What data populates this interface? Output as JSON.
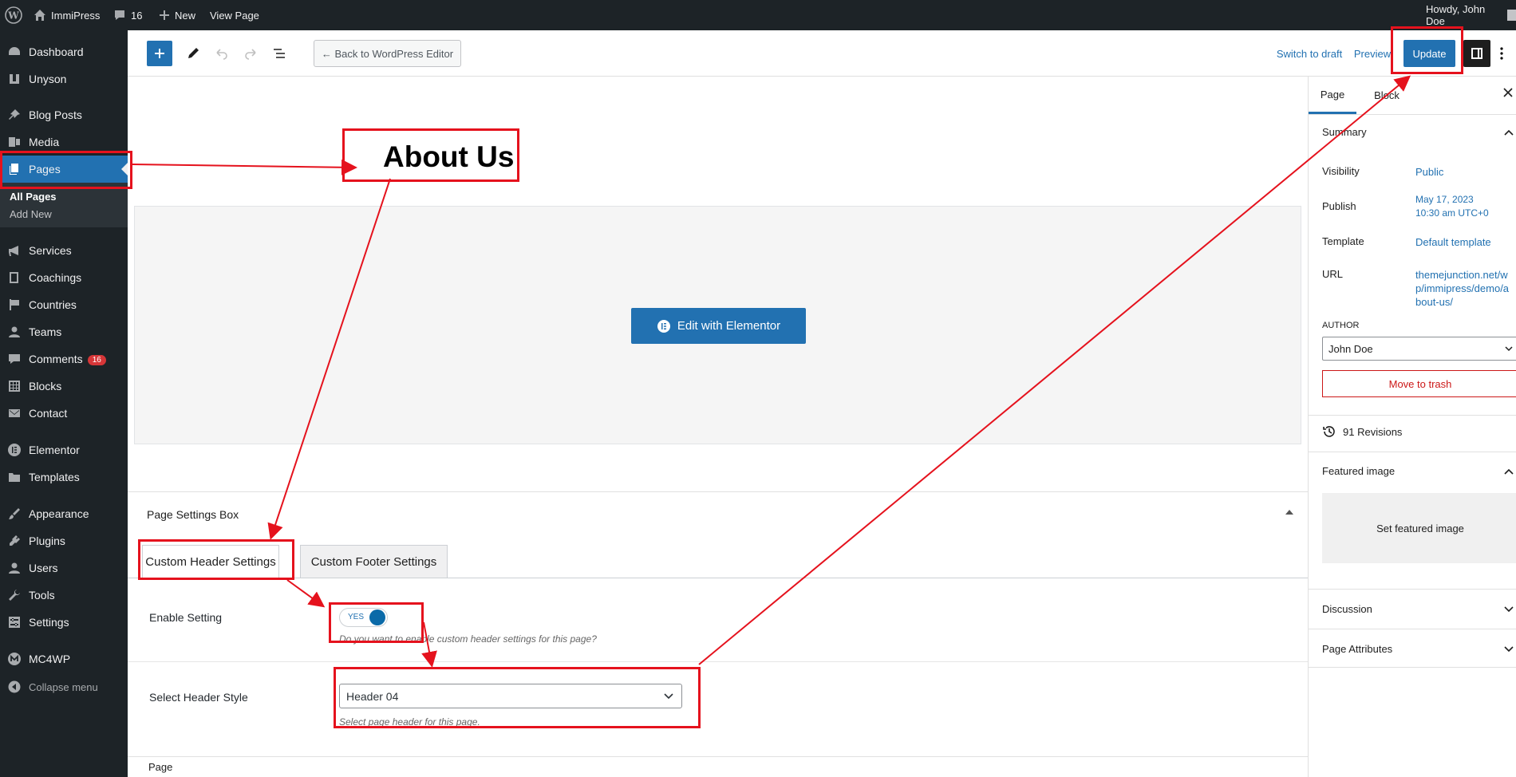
{
  "admin_bar": {
    "site_name": "ImmiPress",
    "comment_count": "16",
    "new_label": "New",
    "view_page": "View Page",
    "greeting": "Howdy, John Doe"
  },
  "sidebar": {
    "items": [
      {
        "label": "Dashboard",
        "icon": "dashboard-icon"
      },
      {
        "label": "Unyson",
        "icon": "unyson-icon"
      },
      {
        "label": "Blog Posts",
        "icon": "pin-icon"
      },
      {
        "label": "Media",
        "icon": "media-icon"
      },
      {
        "label": "Pages",
        "icon": "pages-icon"
      },
      {
        "label": "Services",
        "icon": "megaphone-icon"
      },
      {
        "label": "Coachings",
        "icon": "book-icon"
      },
      {
        "label": "Countries",
        "icon": "flag-icon"
      },
      {
        "label": "Teams",
        "icon": "person-icon"
      },
      {
        "label": "Comments",
        "icon": "comment-icon",
        "badge": "16"
      },
      {
        "label": "Blocks",
        "icon": "grid-icon"
      },
      {
        "label": "Contact",
        "icon": "mail-icon"
      },
      {
        "label": "Elementor",
        "icon": "elementor-icon"
      },
      {
        "label": "Templates",
        "icon": "folder-icon"
      },
      {
        "label": "Appearance",
        "icon": "brush-icon"
      },
      {
        "label": "Plugins",
        "icon": "plug-icon"
      },
      {
        "label": "Users",
        "icon": "person-icon"
      },
      {
        "label": "Tools",
        "icon": "wrench-icon"
      },
      {
        "label": "Settings",
        "icon": "sliders-icon"
      },
      {
        "label": "MC4WP",
        "icon": "mc4wp-icon"
      },
      {
        "label": "Collapse menu",
        "icon": "collapse-icon"
      }
    ],
    "sub_all_pages": "All Pages",
    "sub_add_new": "Add New"
  },
  "toolbar": {
    "back_label": "← Back to WordPress Editor",
    "switch_draft": "Switch to draft",
    "preview": "Preview",
    "update": "Update"
  },
  "editor": {
    "title": "About Us",
    "elementor_button": "Edit with Elementor",
    "settings_box_title": "Page Settings Box",
    "tab_header": "Custom Header Settings",
    "tab_footer": "Custom Footer Settings",
    "enable_label": "Enable Setting",
    "toggle_text": "YES",
    "enable_help": "Do you want to enable custom header settings for this page?",
    "header_style_label": "Select Header Style",
    "header_style_value": "Header 04",
    "header_style_help": "Select page header for this page.",
    "footer_breadcrumb": "Page"
  },
  "panel": {
    "tab_page": "Page",
    "tab_block": "Block",
    "summary": "Summary",
    "visibility_label": "Visibility",
    "visibility_value": "Public",
    "publish_label": "Publish",
    "publish_date": "May 17, 2023",
    "publish_time": "10:30 am UTC+0",
    "template_label": "Template",
    "template_value": "Default template",
    "url_label": "URL",
    "url_line1": "themejunction.net/w",
    "url_line2": "p/immipress/demo/a",
    "url_line3": "bout-us/",
    "author_label": "AUTHOR",
    "author_value": "John Doe",
    "trash": "Move to trash",
    "revisions": "91 Revisions",
    "featured_image": "Featured image",
    "set_featured": "Set featured image",
    "discussion": "Discussion",
    "page_attributes": "Page Attributes"
  },
  "colors": {
    "admin_bg": "#1d2327",
    "accent": "#2271b1",
    "elementor_btn": "#2271b1",
    "annotation": "#e5121d"
  }
}
